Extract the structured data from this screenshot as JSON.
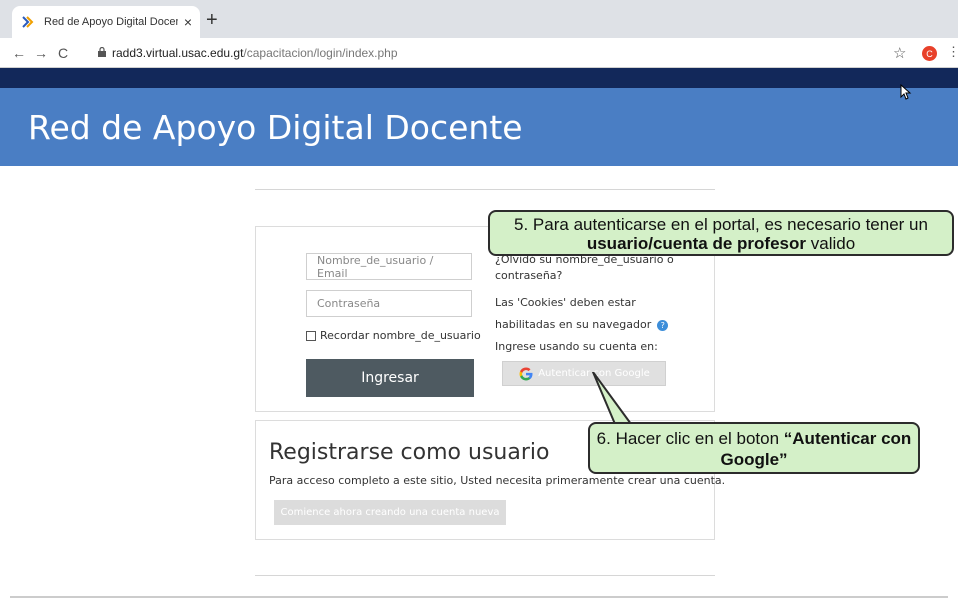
{
  "browser": {
    "tab_title": "Red de Apoyo Digital Docente",
    "tab_close": "×",
    "new_tab": "+",
    "url_host": "radd3.virtual.usac.edu.gt",
    "url_path": "/capacitacion/login/index.php",
    "profile_initial": "C"
  },
  "site": {
    "title": "Red de Apoyo Digital Docente"
  },
  "login": {
    "username_placeholder": "Nombre_de_usuario / Email",
    "password_placeholder": "Contraseña",
    "remember_label": "Recordar nombre_de_usuario",
    "submit_label": "Ingresar",
    "forgot_line1": "¿Olvidó su nombre_de_usuario o",
    "forgot_line2": "contraseña?",
    "cookies_line1": "Las 'Cookies' deben estar",
    "cookies_line2": "habilitadas en su navegador",
    "oauth_label": "Ingrese usando su cuenta en:",
    "google_button": "Autenticar con Google"
  },
  "register": {
    "title": "Registrarse como usuario",
    "text": "Para acceso completo a este sitio, Usted necesita primeramente crear una cuenta.",
    "button": "Comience ahora creando una cuenta nueva"
  },
  "callouts": {
    "step5_prefix": "5. Para autenticarse en el portal, es necesario tener un",
    "step5_bold": "usuario/cuenta de profesor",
    "step5_suffix": " valido",
    "step6_prefix": "6. Hacer clic en el boton ",
    "step6_bold": "“Autenticar con Google”"
  },
  "colors": {
    "navbar": "#12285a",
    "banner": "#4a7ec4",
    "primary_button": "#4e5a61",
    "callout_bg": "#d4f0c8"
  }
}
